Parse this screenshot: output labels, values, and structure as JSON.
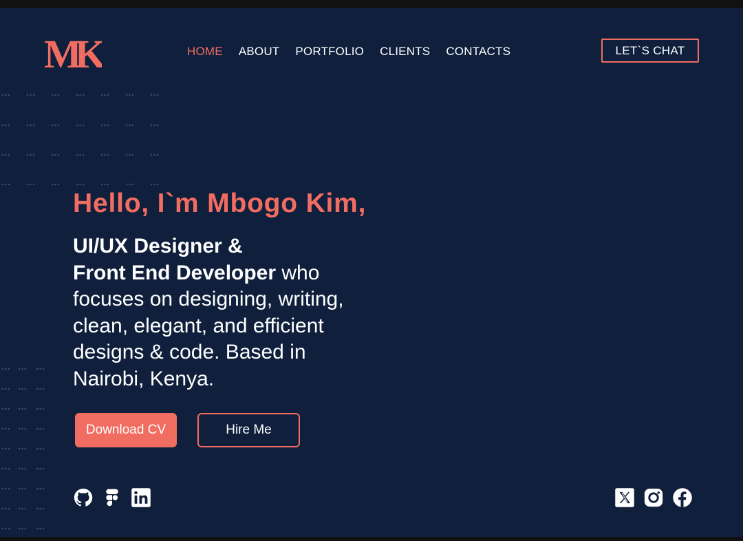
{
  "logo": {
    "text": "MK"
  },
  "nav": {
    "items": [
      {
        "label": "HOME",
        "active": true
      },
      {
        "label": "ABOUT"
      },
      {
        "label": "PORTFOLIO"
      },
      {
        "label": "CLIENTS"
      },
      {
        "label": "CONTACTS"
      }
    ],
    "cta_label": "LET`S CHAT"
  },
  "hero": {
    "greeting": "Hello, I`m Mbogo Kim,",
    "role_line1": "UI/UX Designer &",
    "role_line2": "Front End Developer",
    "description": " who focuses on designing, writing, clean, elegant, and efficient designs & code. Based in Nairobi, Kenya.",
    "download_label": "Download CV",
    "hire_label": "Hire Me"
  },
  "social_left": [
    "github-icon",
    "figma-icon",
    "linkedin-icon"
  ],
  "social_right": [
    "x-icon",
    "instagram-icon",
    "facebook-icon"
  ],
  "colors": {
    "background": "#0f1f3c",
    "accent": "#f26d61",
    "text": "#ffffff"
  }
}
